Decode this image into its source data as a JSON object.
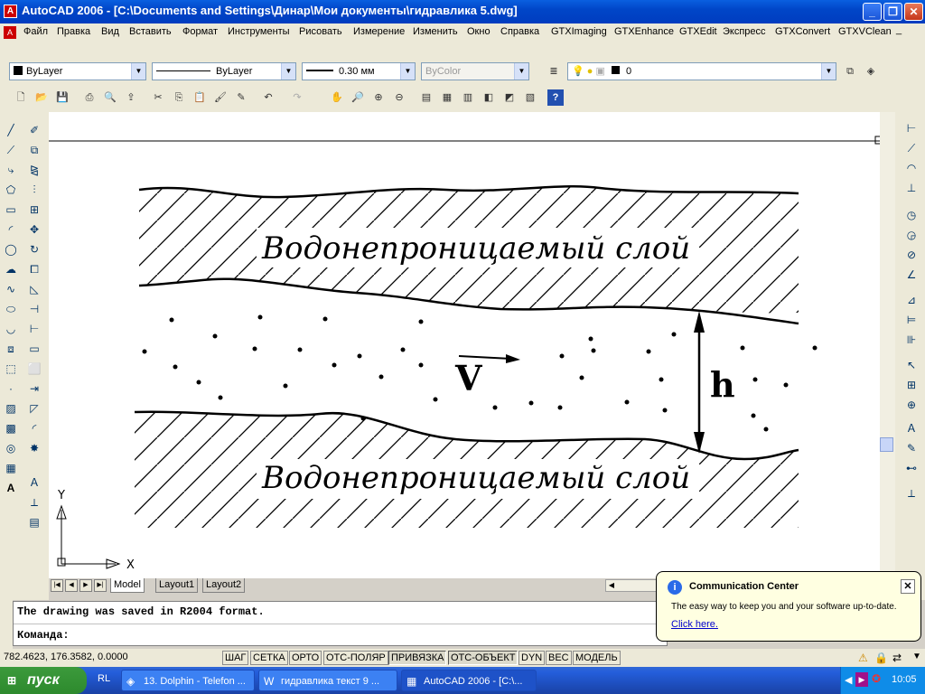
{
  "window": {
    "title": "AutoCAD 2006 - [C:\\Documents and Settings\\Динар\\Мои документы\\гидравлика 5.dwg]"
  },
  "menu": [
    "Файл",
    "Правка",
    "Вид",
    "Вставить",
    "Формат",
    "Инструменты",
    "Рисовать",
    "Измерение",
    "Изменить",
    "Окно",
    "Справка",
    "GTXImaging",
    "GTXEnhance",
    "GTXEdit",
    "Экспресс",
    "GTXConvert",
    "GTXVClean"
  ],
  "properties": {
    "color": "ByLayer",
    "linetype": "ByLayer",
    "lineweight": "0.30 мм",
    "plotstyle": "ByColor",
    "layer": "0"
  },
  "drawing": {
    "top_label": "Водонепроницаемый слой",
    "bottom_label": "Водонепроницаемый слой",
    "velocity": "V",
    "height": "h",
    "axis_x": "X",
    "axis_y": "Y"
  },
  "tabs": [
    "Model",
    "Layout1",
    "Layout2"
  ],
  "command": {
    "history": "The drawing was saved in R2004 format.",
    "prompt": "Команда:"
  },
  "status": {
    "coords": "782.4623, 176.3582, 0.0000",
    "toggles": [
      {
        "label": "ШАГ",
        "on": false
      },
      {
        "label": "СЕТКА",
        "on": false
      },
      {
        "label": "ОРТО",
        "on": false
      },
      {
        "label": "ОТС-ПОЛЯР",
        "on": false
      },
      {
        "label": "ПРИВЯЗКА",
        "on": true
      },
      {
        "label": "ОТС-ОБЪЕКТ",
        "on": true
      },
      {
        "label": "DYN",
        "on": false
      },
      {
        "label": "ВЕС",
        "on": false
      },
      {
        "label": "МОДЕЛЬ",
        "on": false
      }
    ]
  },
  "balloon": {
    "title": "Communication Center",
    "body": "The easy way to keep you and your software up-to-date.",
    "link": "Click here."
  },
  "taskbar": {
    "start": "пуск",
    "quicklaunch": "RL",
    "tasks": [
      "13. Dolphin - Telefon ...",
      "гидравлика текст 9 ...",
      "AutoCAD 2006 - [C:\\..."
    ],
    "time": "10:05"
  }
}
